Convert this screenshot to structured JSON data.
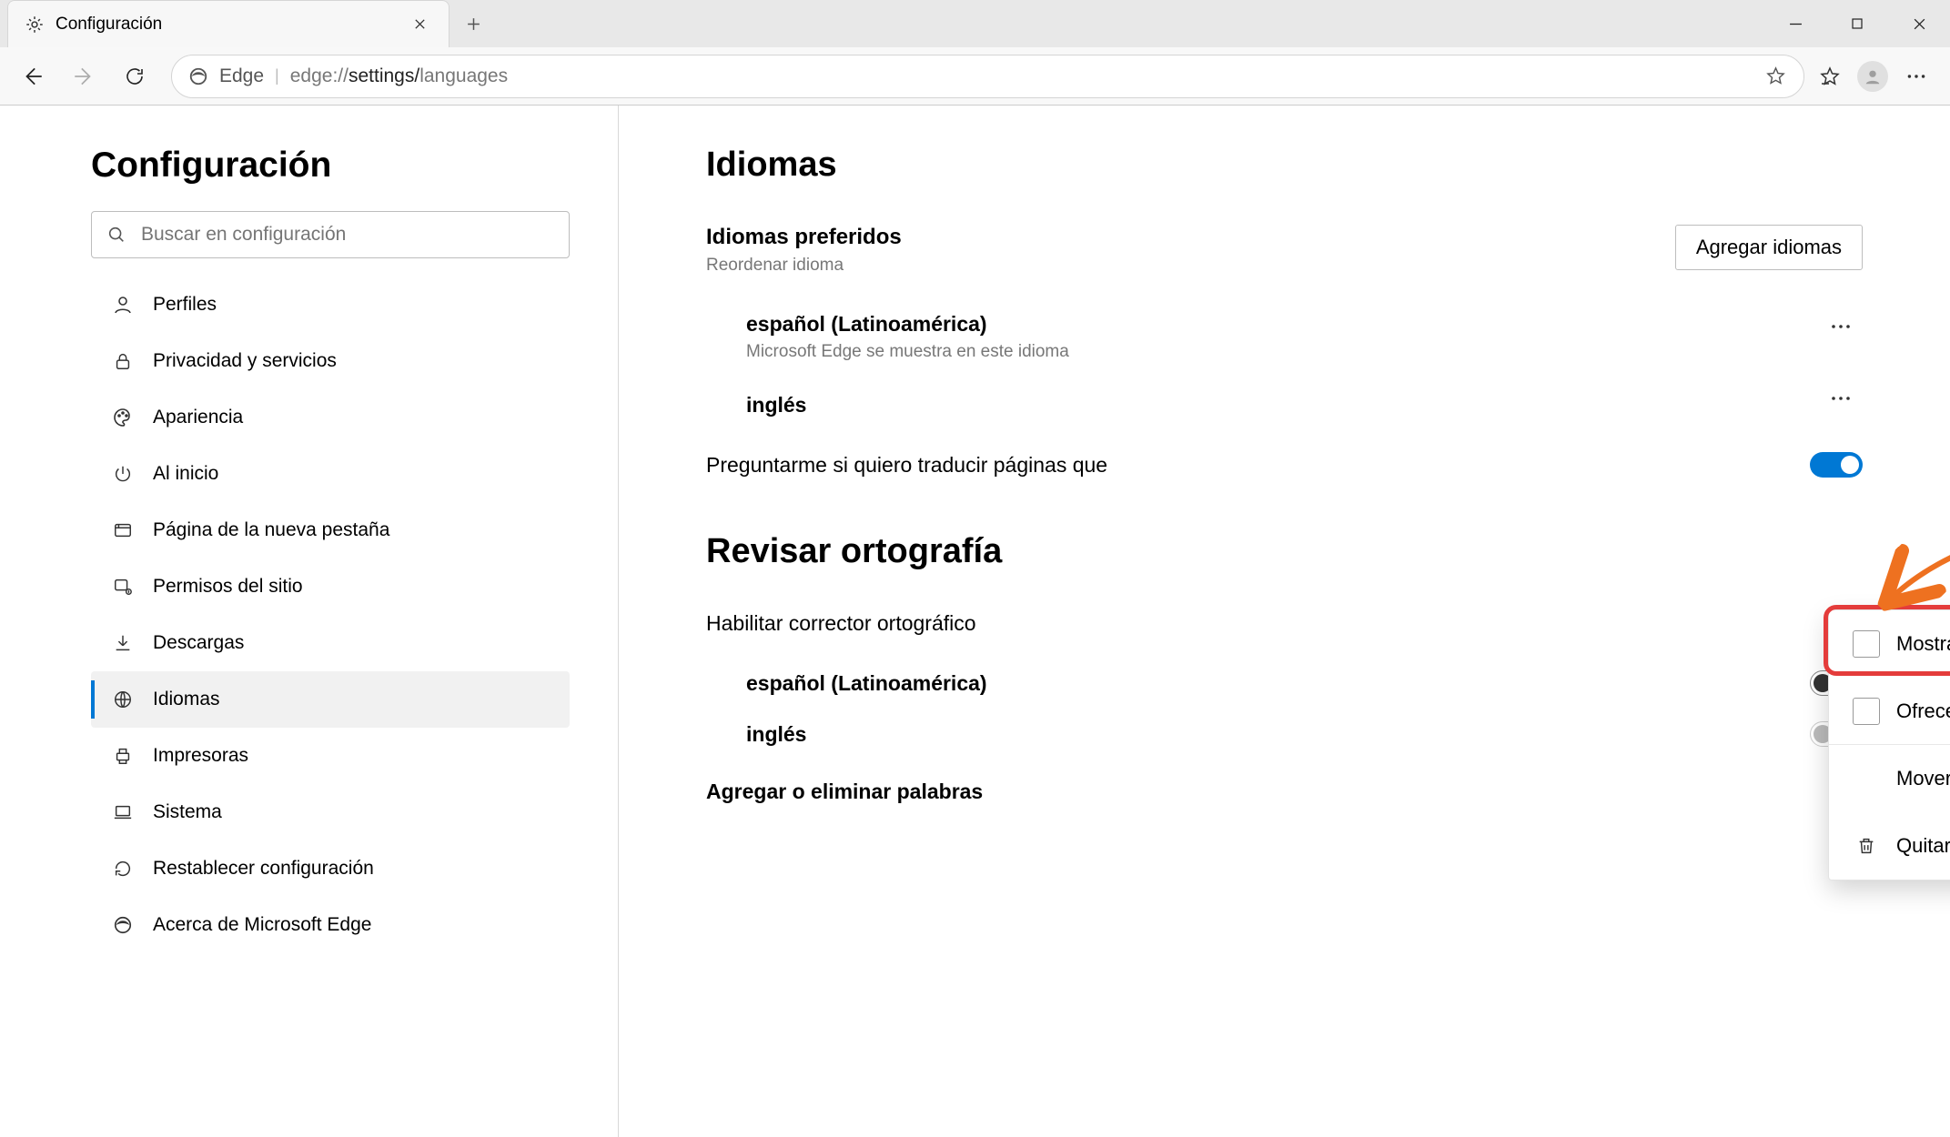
{
  "tab": {
    "title": "Configuración"
  },
  "omnibox": {
    "prefix": "Edge",
    "url_gray_left": "edge://",
    "url_dark": "settings/",
    "url_gray_right": "languages"
  },
  "sidebar": {
    "title": "Configuración",
    "search_placeholder": "Buscar en configuración",
    "items": [
      {
        "label": "Perfiles"
      },
      {
        "label": "Privacidad y servicios"
      },
      {
        "label": "Apariencia"
      },
      {
        "label": "Al inicio"
      },
      {
        "label": "Página de la nueva pestaña"
      },
      {
        "label": "Permisos del sitio"
      },
      {
        "label": "Descargas"
      },
      {
        "label": "Idiomas"
      },
      {
        "label": "Impresoras"
      },
      {
        "label": "Sistema"
      },
      {
        "label": "Restablecer configuración"
      },
      {
        "label": "Acerca de Microsoft Edge"
      }
    ]
  },
  "languages": {
    "heading": "Idiomas",
    "preferred_label": "Idiomas preferidos",
    "reorder_hint": "Reordenar idioma",
    "add_button": "Agregar idiomas",
    "items": [
      {
        "name": "español (Latinoamérica)",
        "sub": "Microsoft Edge se muestra en este idioma"
      },
      {
        "name": "inglés",
        "sub": ""
      }
    ],
    "offer_translate_prefix": "Preguntarme si quiero traducir páginas que"
  },
  "menu": {
    "show_edge": "Mostrar Microsoft Edge en este idioma",
    "offer_translate": "Ofrecer la traducción de paginas en este idioma",
    "move_top": "Mover a la parte superior",
    "remove": "Quitar"
  },
  "spellcheck": {
    "heading": "Revisar ortografía",
    "enable_label": "Habilitar corrector ortográfico",
    "items": [
      {
        "name": "español (Latinoamérica)"
      },
      {
        "name": "inglés"
      }
    ],
    "dictionary": "Agregar o eliminar palabras"
  }
}
